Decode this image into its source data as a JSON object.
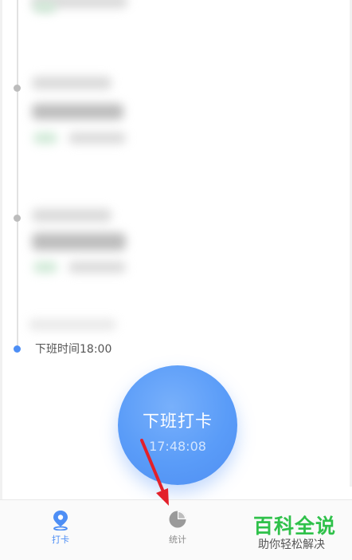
{
  "timeline": {
    "off_duty_time_label": "下班时间18:00"
  },
  "clock_button": {
    "label": "下班打卡",
    "time": "17:48:08"
  },
  "bottom_nav": {
    "items": [
      {
        "label": "打卡",
        "icon": "location-pin-icon",
        "active": true
      },
      {
        "label": "统计",
        "icon": "pie-chart-icon",
        "active": false
      }
    ]
  },
  "watermark": {
    "title": "百科全说",
    "subtitle": "助你轻松解决"
  },
  "colors": {
    "accent": "#4d8ef5",
    "annotation_arrow": "#e3202a",
    "watermark_green": "#2fc14a"
  }
}
